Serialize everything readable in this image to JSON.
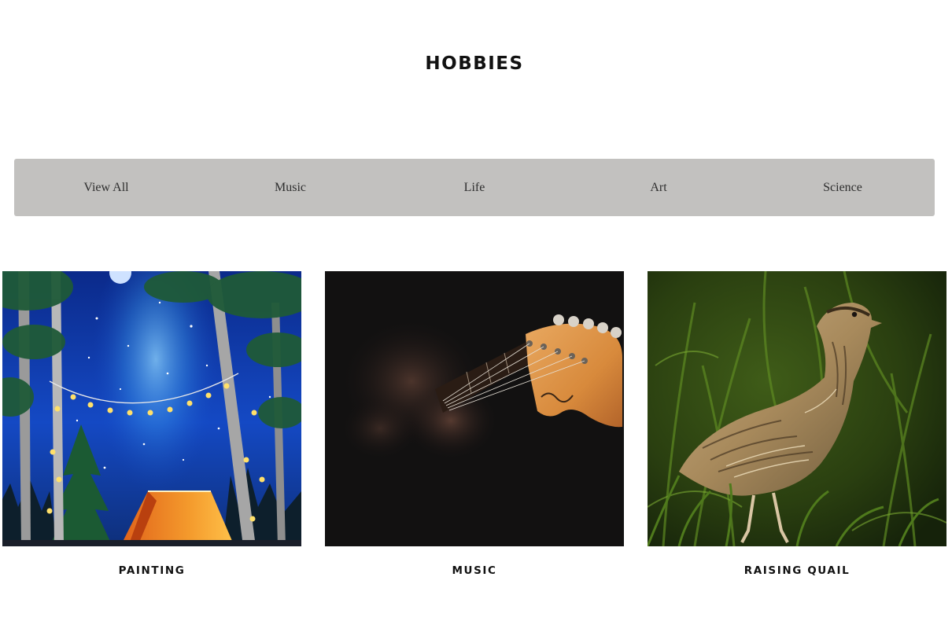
{
  "page": {
    "title": "HOBBIES"
  },
  "filters": [
    {
      "label": "View All"
    },
    {
      "label": "Music"
    },
    {
      "label": "Life"
    },
    {
      "label": "Art"
    },
    {
      "label": "Science"
    }
  ],
  "cards": [
    {
      "title": "PAINTING",
      "image": "night-camping-painting"
    },
    {
      "title": "MUSIC",
      "image": "guitar-headstock-photo"
    },
    {
      "title": "RAISING QUAIL",
      "image": "quail-in-grass-photo"
    }
  ],
  "colors": {
    "filter_bar_bg": "#c2c1bf",
    "text": "#111111"
  }
}
